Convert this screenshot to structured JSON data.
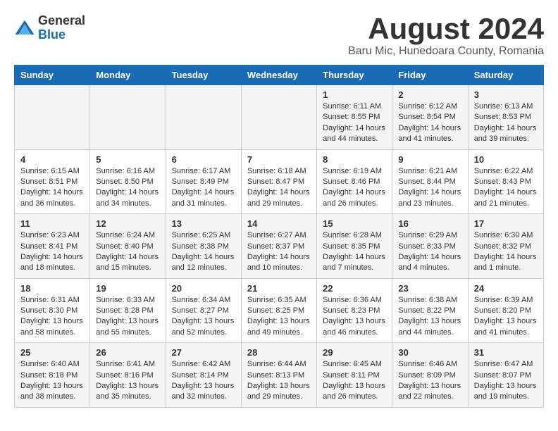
{
  "logo": {
    "general": "General",
    "blue": "Blue"
  },
  "title": "August 2024",
  "location": "Baru Mic, Hunedoara County, Romania",
  "days_of_week": [
    "Sunday",
    "Monday",
    "Tuesday",
    "Wednesday",
    "Thursday",
    "Friday",
    "Saturday"
  ],
  "weeks": [
    [
      {
        "day": "",
        "info": ""
      },
      {
        "day": "",
        "info": ""
      },
      {
        "day": "",
        "info": ""
      },
      {
        "day": "",
        "info": ""
      },
      {
        "day": "1",
        "info": "Sunrise: 6:11 AM\nSunset: 8:55 PM\nDaylight: 14 hours and 44 minutes."
      },
      {
        "day": "2",
        "info": "Sunrise: 6:12 AM\nSunset: 8:54 PM\nDaylight: 14 hours and 41 minutes."
      },
      {
        "day": "3",
        "info": "Sunrise: 6:13 AM\nSunset: 8:53 PM\nDaylight: 14 hours and 39 minutes."
      }
    ],
    [
      {
        "day": "4",
        "info": "Sunrise: 6:15 AM\nSunset: 8:51 PM\nDaylight: 14 hours and 36 minutes."
      },
      {
        "day": "5",
        "info": "Sunrise: 6:16 AM\nSunset: 8:50 PM\nDaylight: 14 hours and 34 minutes."
      },
      {
        "day": "6",
        "info": "Sunrise: 6:17 AM\nSunset: 8:49 PM\nDaylight: 14 hours and 31 minutes."
      },
      {
        "day": "7",
        "info": "Sunrise: 6:18 AM\nSunset: 8:47 PM\nDaylight: 14 hours and 29 minutes."
      },
      {
        "day": "8",
        "info": "Sunrise: 6:19 AM\nSunset: 8:46 PM\nDaylight: 14 hours and 26 minutes."
      },
      {
        "day": "9",
        "info": "Sunrise: 6:21 AM\nSunset: 8:44 PM\nDaylight: 14 hours and 23 minutes."
      },
      {
        "day": "10",
        "info": "Sunrise: 6:22 AM\nSunset: 8:43 PM\nDaylight: 14 hours and 21 minutes."
      }
    ],
    [
      {
        "day": "11",
        "info": "Sunrise: 6:23 AM\nSunset: 8:41 PM\nDaylight: 14 hours and 18 minutes."
      },
      {
        "day": "12",
        "info": "Sunrise: 6:24 AM\nSunset: 8:40 PM\nDaylight: 14 hours and 15 minutes."
      },
      {
        "day": "13",
        "info": "Sunrise: 6:25 AM\nSunset: 8:38 PM\nDaylight: 14 hours and 12 minutes."
      },
      {
        "day": "14",
        "info": "Sunrise: 6:27 AM\nSunset: 8:37 PM\nDaylight: 14 hours and 10 minutes."
      },
      {
        "day": "15",
        "info": "Sunrise: 6:28 AM\nSunset: 8:35 PM\nDaylight: 14 hours and 7 minutes."
      },
      {
        "day": "16",
        "info": "Sunrise: 6:29 AM\nSunset: 8:33 PM\nDaylight: 14 hours and 4 minutes."
      },
      {
        "day": "17",
        "info": "Sunrise: 6:30 AM\nSunset: 8:32 PM\nDaylight: 14 hours and 1 minute."
      }
    ],
    [
      {
        "day": "18",
        "info": "Sunrise: 6:31 AM\nSunset: 8:30 PM\nDaylight: 13 hours and 58 minutes."
      },
      {
        "day": "19",
        "info": "Sunrise: 6:33 AM\nSunset: 8:28 PM\nDaylight: 13 hours and 55 minutes."
      },
      {
        "day": "20",
        "info": "Sunrise: 6:34 AM\nSunset: 8:27 PM\nDaylight: 13 hours and 52 minutes."
      },
      {
        "day": "21",
        "info": "Sunrise: 6:35 AM\nSunset: 8:25 PM\nDaylight: 13 hours and 49 minutes."
      },
      {
        "day": "22",
        "info": "Sunrise: 6:36 AM\nSunset: 8:23 PM\nDaylight: 13 hours and 46 minutes."
      },
      {
        "day": "23",
        "info": "Sunrise: 6:38 AM\nSunset: 8:22 PM\nDaylight: 13 hours and 44 minutes."
      },
      {
        "day": "24",
        "info": "Sunrise: 6:39 AM\nSunset: 8:20 PM\nDaylight: 13 hours and 41 minutes."
      }
    ],
    [
      {
        "day": "25",
        "info": "Sunrise: 6:40 AM\nSunset: 8:18 PM\nDaylight: 13 hours and 38 minutes."
      },
      {
        "day": "26",
        "info": "Sunrise: 6:41 AM\nSunset: 8:16 PM\nDaylight: 13 hours and 35 minutes."
      },
      {
        "day": "27",
        "info": "Sunrise: 6:42 AM\nSunset: 8:14 PM\nDaylight: 13 hours and 32 minutes."
      },
      {
        "day": "28",
        "info": "Sunrise: 6:44 AM\nSunset: 8:13 PM\nDaylight: 13 hours and 29 minutes."
      },
      {
        "day": "29",
        "info": "Sunrise: 6:45 AM\nSunset: 8:11 PM\nDaylight: 13 hours and 26 minutes."
      },
      {
        "day": "30",
        "info": "Sunrise: 6:46 AM\nSunset: 8:09 PM\nDaylight: 13 hours and 22 minutes."
      },
      {
        "day": "31",
        "info": "Sunrise: 6:47 AM\nSunset: 8:07 PM\nDaylight: 13 hours and 19 minutes."
      }
    ]
  ]
}
